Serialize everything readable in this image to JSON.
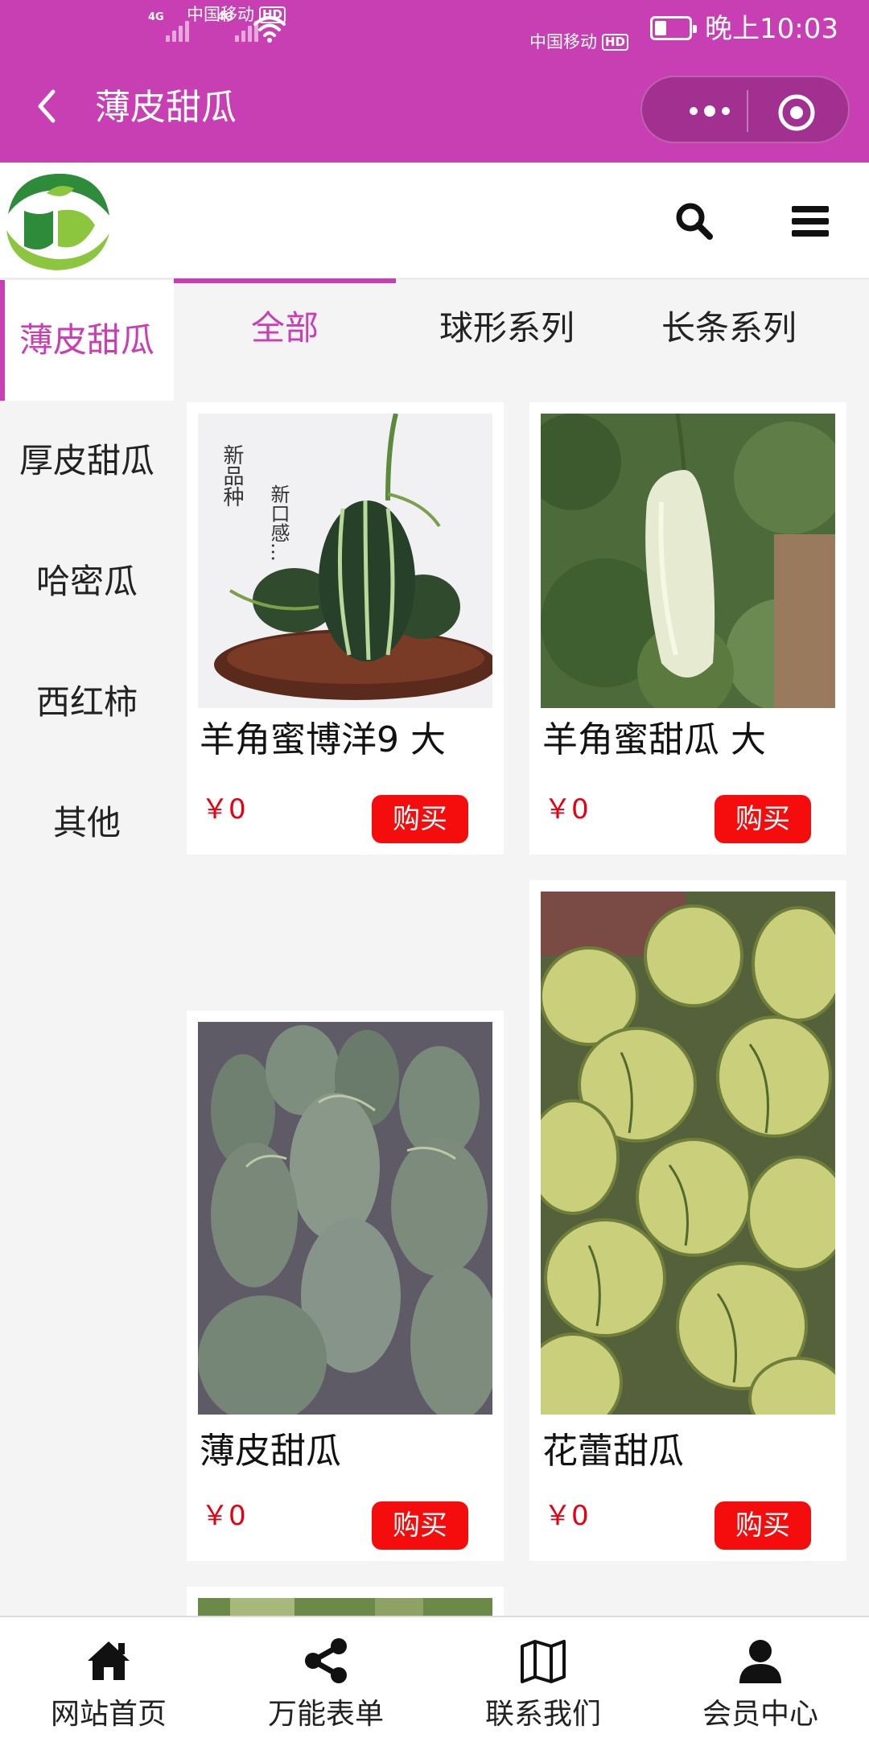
{
  "status_bar": {
    "carrier_1": "中国移动",
    "carrier_2": "中国移动",
    "hd_badge": "HD",
    "network_1": "4G",
    "network_2": "4G",
    "battery_level": 0.35,
    "time": "晚上10:03"
  },
  "title_bar": {
    "title": "薄皮甜瓜",
    "back_icon": "chevron-left-icon",
    "more_icon": "more-dots-icon",
    "close_icon": "target-circle-icon"
  },
  "header": {
    "logo_icon": "farm-logo-icon",
    "search_icon": "search-icon",
    "menu_icon": "hamburger-menu-icon"
  },
  "categories": [
    {
      "label": "薄皮甜瓜",
      "active": true
    },
    {
      "label": "厚皮甜瓜",
      "active": false
    },
    {
      "label": "哈密瓜",
      "active": false
    },
    {
      "label": "西红柿",
      "active": false
    },
    {
      "label": "其他",
      "active": false
    }
  ],
  "tabs": [
    {
      "label": "全部",
      "active": true
    },
    {
      "label": "球形系列",
      "active": false
    },
    {
      "label": "长条系列",
      "active": false
    }
  ],
  "products": [
    {
      "name": "羊角蜜博洋9 大",
      "price": "￥0",
      "buy_label": "购买",
      "image_text_1": "新品种",
      "image_text_2": "新口感…"
    },
    {
      "name": "羊角蜜甜瓜 大",
      "price": "￥0",
      "buy_label": "购买"
    },
    {
      "name": "薄皮甜瓜",
      "price": "￥0",
      "buy_label": "购买"
    },
    {
      "name": "花蕾甜瓜",
      "price": "￥0",
      "buy_label": "购买"
    }
  ],
  "bottom_nav": [
    {
      "label": "网站首页",
      "icon": "home-icon"
    },
    {
      "label": "万能表单",
      "icon": "share-icon"
    },
    {
      "label": "联系我们",
      "icon": "map-icon"
    },
    {
      "label": "会员中心",
      "icon": "user-icon"
    }
  ],
  "colors": {
    "brand": "#c83fb4",
    "price": "#e60012",
    "buy_button": "#f50c0c"
  }
}
